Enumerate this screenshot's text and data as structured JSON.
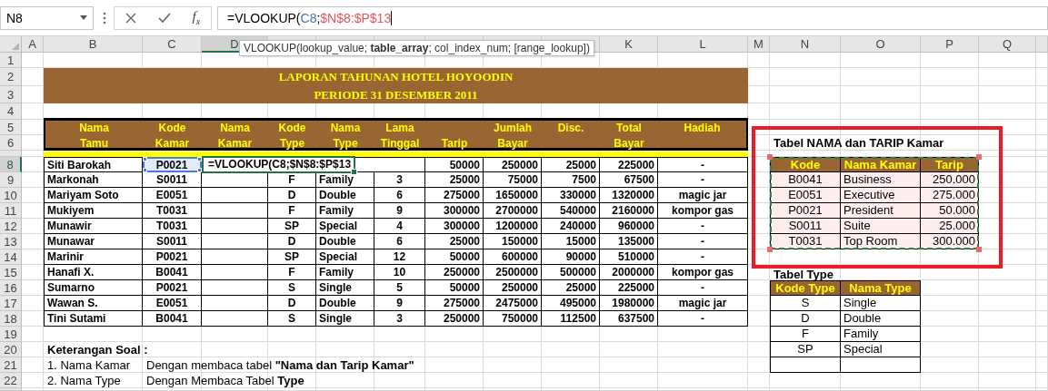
{
  "formula_bar": {
    "name_box": "N8",
    "function_label": "f$_{x}$",
    "formula_parts": [
      {
        "text": "=VLOOKUP("
      },
      {
        "text": "C8",
        "color": "#4472c4"
      },
      {
        "text": ";"
      },
      {
        "text": "$N$8:$P$13",
        "color": "#e8545a"
      }
    ]
  },
  "tooltip": "VLOOKUP(lookup_value; **table_array**; col_index_num; [range_lookup])",
  "column_headers": [
    {
      "label": "A",
      "selected": false
    },
    {
      "label": "B",
      "selected": false
    },
    {
      "label": "C",
      "selected": false
    },
    {
      "label": "D",
      "selected": true
    },
    {
      "label": "K",
      "selected": false
    },
    {
      "label": "L",
      "selected": false
    },
    {
      "label": "M",
      "selected": false
    },
    {
      "label": "N",
      "selected": false
    },
    {
      "label": "O",
      "selected": false
    },
    {
      "label": "P",
      "selected": false
    },
    {
      "label": "Q",
      "selected": false
    }
  ],
  "row_headers": [
    {
      "label": "1",
      "selected": false
    },
    {
      "label": "2",
      "selected": false
    },
    {
      "label": "3",
      "selected": false
    },
    {
      "label": "4",
      "selected": false
    },
    {
      "label": "5",
      "selected": false
    },
    {
      "label": "6",
      "selected": false
    },
    {
      "label": "8",
      "selected": true
    },
    {
      "label": "9",
      "selected": false
    },
    {
      "label": "10",
      "selected": false
    },
    {
      "label": "11",
      "selected": false
    },
    {
      "label": "12",
      "selected": false
    },
    {
      "label": "13",
      "selected": false
    },
    {
      "label": "14",
      "selected": false
    },
    {
      "label": "15",
      "selected": false
    },
    {
      "label": "16",
      "selected": false
    },
    {
      "label": "17",
      "selected": false
    },
    {
      "label": "18",
      "selected": false
    },
    {
      "label": "19",
      "selected": false
    },
    {
      "label": "20",
      "selected": false
    },
    {
      "label": "21",
      "selected": false
    },
    {
      "label": "22",
      "selected": false
    }
  ],
  "report": {
    "title": "LAPORAN TAHUNAN HOTEL HOYOODIN",
    "period": "PERIODE 31 DESEMBER 2011"
  },
  "main_table": {
    "columns": [
      {
        "top": "Nama",
        "bottom": "Tamu"
      },
      {
        "top": "Kode",
        "bottom": "Kamar"
      },
      {
        "top": "Nama",
        "bottom": "Kamar"
      },
      {
        "top": "Kode",
        "bottom": "Type"
      },
      {
        "top": "Nama",
        "bottom": "Type"
      },
      {
        "top": "Lama",
        "bottom": "Tinggal"
      },
      {
        "bottom": "Tarip"
      },
      {
        "top": "Jumlah",
        "bottom": "Bayar"
      },
      {
        "top": "Disc."
      },
      {
        "top": "Total",
        "bottom": "Bayar"
      },
      {
        "top": "Hadiah"
      }
    ],
    "rows": [
      {
        "editing": true,
        "kode_referenced": true,
        "nama_tamu": "Siti Barokah",
        "kode_kamar": "P0021",
        "nama_kamar": "=VLOOKUP(C8;$N$8:$P$13",
        "tarip": "50000",
        "jumlah_bayar": "250000",
        "disc": "25000",
        "total_bayar": "225000",
        "hadiah": "-"
      },
      {
        "editing": false,
        "kode_referenced": false,
        "nama_tamu": "Markonah",
        "kode_kamar": "S0011",
        "kode_type": "F",
        "nama_type": "Family",
        "lama_tinggal": "3",
        "tarip": "25000",
        "jumlah_bayar": "75000",
        "disc": "7500",
        "total_bayar": "67500",
        "hadiah": "-"
      },
      {
        "editing": false,
        "kode_referenced": false,
        "nama_tamu": "Mariyam Soto",
        "kode_kamar": "E0051",
        "kode_type": "D",
        "nama_type": "Double",
        "lama_tinggal": "6",
        "tarip": "275000",
        "jumlah_bayar": "1650000",
        "disc": "330000",
        "total_bayar": "1320000",
        "hadiah": "magic jar"
      },
      {
        "editing": false,
        "kode_referenced": false,
        "nama_tamu": "Mukiyem",
        "kode_kamar": "T0031",
        "kode_type": "F",
        "nama_type": "Family",
        "lama_tinggal": "9",
        "tarip": "300000",
        "jumlah_bayar": "2700000",
        "disc": "540000",
        "total_bayar": "2160000",
        "hadiah": "kompor gas"
      },
      {
        "editing": false,
        "kode_referenced": false,
        "nama_tamu": "Munawir",
        "kode_kamar": "T0031",
        "kode_type": "SP",
        "nama_type": "Special",
        "lama_tinggal": "4",
        "tarip": "300000",
        "jumlah_bayar": "1200000",
        "disc": "240000",
        "total_bayar": "960000",
        "hadiah": "-"
      },
      {
        "editing": false,
        "kode_referenced": false,
        "nama_tamu": "Munawar",
        "kode_kamar": "S0011",
        "kode_type": "D",
        "nama_type": "Double",
        "lama_tinggal": "6",
        "tarip": "25000",
        "jumlah_bayar": "150000",
        "disc": "15000",
        "total_bayar": "135000",
        "hadiah": "-"
      },
      {
        "editing": false,
        "kode_referenced": false,
        "nama_tamu": "Marinir",
        "kode_kamar": "P0021",
        "kode_type": "SP",
        "nama_type": "Special",
        "lama_tinggal": "12",
        "tarip": "50000",
        "jumlah_bayar": "600000",
        "disc": "90000",
        "total_bayar": "510000",
        "hadiah": "-"
      },
      {
        "editing": false,
        "kode_referenced": false,
        "nama_tamu": "Hanafi X.",
        "kode_kamar": "B0041",
        "kode_type": "F",
        "nama_type": "Family",
        "lama_tinggal": "10",
        "tarip": "250000",
        "jumlah_bayar": "2500000",
        "disc": "500000",
        "total_bayar": "2000000",
        "hadiah": "kompor gas"
      },
      {
        "editing": false,
        "kode_referenced": false,
        "nama_tamu": "Sumarno",
        "kode_kamar": "P0021",
        "kode_type": "S",
        "nama_type": "Single",
        "lama_tinggal": "5",
        "tarip": "50000",
        "jumlah_bayar": "250000",
        "disc": "25000",
        "total_bayar": "225000",
        "hadiah": "-"
      },
      {
        "editing": false,
        "kode_referenced": false,
        "nama_tamu": "Wawan S.",
        "kode_kamar": "E0051",
        "kode_type": "D",
        "nama_type": "Double",
        "lama_tinggal": "9",
        "tarip": "275000",
        "jumlah_bayar": "2475000",
        "disc": "495000",
        "total_bayar": "1980000",
        "hadiah": "magic jar"
      },
      {
        "editing": false,
        "kode_referenced": false,
        "nama_tamu": "Tini Sutami",
        "kode_kamar": "B0041",
        "kode_type": "S",
        "nama_type": "Single",
        "lama_tinggal": "3",
        "tarip": "250000",
        "jumlah_bayar": "750000",
        "disc": "112500",
        "total_bayar": "637500",
        "hadiah": "-"
      }
    ]
  },
  "notes": {
    "heading": "Keterangan Soal :",
    "items": [
      {
        "label": "1. Nama Kamar",
        "text": "Dengan membaca tabel **\"Nama dan Tarip Kamar\"**"
      },
      {
        "label": "2. Nama Type",
        "text": "Dengan Membaca Tabel **Type**"
      }
    ]
  },
  "room_table": {
    "title": "Tabel NAMA dan TARIP Kamar",
    "referenced": true,
    "columns": [
      "Kode",
      "Nama Kamar",
      "Tarip"
    ],
    "rows": [
      [
        "B0041",
        "Business",
        "250.000"
      ],
      [
        "E0051",
        "Executive",
        "275.000"
      ],
      [
        "P0021",
        "President",
        "50.000"
      ],
      [
        "S0011",
        "Suite",
        "25.000"
      ],
      [
        "T0031",
        "Top Room",
        "300.000"
      ]
    ]
  },
  "type_table": {
    "title": "Tabel Type",
    "columns": [
      "Kode Type",
      "Nama Type"
    ],
    "rows": [
      [
        "S",
        "Single"
      ],
      [
        "D",
        "Double"
      ],
      [
        "F",
        "Family"
      ],
      [
        "SP",
        "Special"
      ]
    ]
  }
}
